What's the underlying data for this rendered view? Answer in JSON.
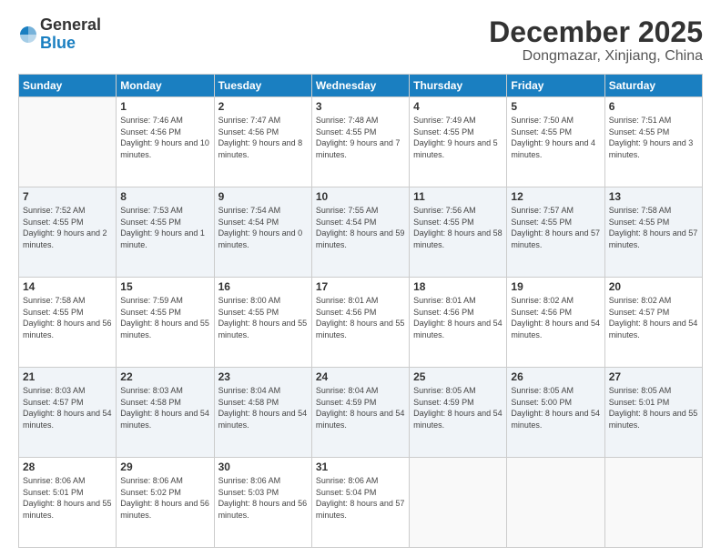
{
  "logo": {
    "general": "General",
    "blue": "Blue"
  },
  "header": {
    "month": "December 2025",
    "location": "Dongmazar, Xinjiang, China"
  },
  "weekdays": [
    "Sunday",
    "Monday",
    "Tuesday",
    "Wednesday",
    "Thursday",
    "Friday",
    "Saturday"
  ],
  "weeks": [
    [
      {
        "day": "",
        "sunrise": "",
        "sunset": "",
        "daylight": ""
      },
      {
        "day": "1",
        "sunrise": "Sunrise: 7:46 AM",
        "sunset": "Sunset: 4:56 PM",
        "daylight": "Daylight: 9 hours and 10 minutes."
      },
      {
        "day": "2",
        "sunrise": "Sunrise: 7:47 AM",
        "sunset": "Sunset: 4:56 PM",
        "daylight": "Daylight: 9 hours and 8 minutes."
      },
      {
        "day": "3",
        "sunrise": "Sunrise: 7:48 AM",
        "sunset": "Sunset: 4:55 PM",
        "daylight": "Daylight: 9 hours and 7 minutes."
      },
      {
        "day": "4",
        "sunrise": "Sunrise: 7:49 AM",
        "sunset": "Sunset: 4:55 PM",
        "daylight": "Daylight: 9 hours and 5 minutes."
      },
      {
        "day": "5",
        "sunrise": "Sunrise: 7:50 AM",
        "sunset": "Sunset: 4:55 PM",
        "daylight": "Daylight: 9 hours and 4 minutes."
      },
      {
        "day": "6",
        "sunrise": "Sunrise: 7:51 AM",
        "sunset": "Sunset: 4:55 PM",
        "daylight": "Daylight: 9 hours and 3 minutes."
      }
    ],
    [
      {
        "day": "7",
        "sunrise": "Sunrise: 7:52 AM",
        "sunset": "Sunset: 4:55 PM",
        "daylight": "Daylight: 9 hours and 2 minutes."
      },
      {
        "day": "8",
        "sunrise": "Sunrise: 7:53 AM",
        "sunset": "Sunset: 4:55 PM",
        "daylight": "Daylight: 9 hours and 1 minute."
      },
      {
        "day": "9",
        "sunrise": "Sunrise: 7:54 AM",
        "sunset": "Sunset: 4:54 PM",
        "daylight": "Daylight: 9 hours and 0 minutes."
      },
      {
        "day": "10",
        "sunrise": "Sunrise: 7:55 AM",
        "sunset": "Sunset: 4:54 PM",
        "daylight": "Daylight: 8 hours and 59 minutes."
      },
      {
        "day": "11",
        "sunrise": "Sunrise: 7:56 AM",
        "sunset": "Sunset: 4:55 PM",
        "daylight": "Daylight: 8 hours and 58 minutes."
      },
      {
        "day": "12",
        "sunrise": "Sunrise: 7:57 AM",
        "sunset": "Sunset: 4:55 PM",
        "daylight": "Daylight: 8 hours and 57 minutes."
      },
      {
        "day": "13",
        "sunrise": "Sunrise: 7:58 AM",
        "sunset": "Sunset: 4:55 PM",
        "daylight": "Daylight: 8 hours and 57 minutes."
      }
    ],
    [
      {
        "day": "14",
        "sunrise": "Sunrise: 7:58 AM",
        "sunset": "Sunset: 4:55 PM",
        "daylight": "Daylight: 8 hours and 56 minutes."
      },
      {
        "day": "15",
        "sunrise": "Sunrise: 7:59 AM",
        "sunset": "Sunset: 4:55 PM",
        "daylight": "Daylight: 8 hours and 55 minutes."
      },
      {
        "day": "16",
        "sunrise": "Sunrise: 8:00 AM",
        "sunset": "Sunset: 4:55 PM",
        "daylight": "Daylight: 8 hours and 55 minutes."
      },
      {
        "day": "17",
        "sunrise": "Sunrise: 8:01 AM",
        "sunset": "Sunset: 4:56 PM",
        "daylight": "Daylight: 8 hours and 55 minutes."
      },
      {
        "day": "18",
        "sunrise": "Sunrise: 8:01 AM",
        "sunset": "Sunset: 4:56 PM",
        "daylight": "Daylight: 8 hours and 54 minutes."
      },
      {
        "day": "19",
        "sunrise": "Sunrise: 8:02 AM",
        "sunset": "Sunset: 4:56 PM",
        "daylight": "Daylight: 8 hours and 54 minutes."
      },
      {
        "day": "20",
        "sunrise": "Sunrise: 8:02 AM",
        "sunset": "Sunset: 4:57 PM",
        "daylight": "Daylight: 8 hours and 54 minutes."
      }
    ],
    [
      {
        "day": "21",
        "sunrise": "Sunrise: 8:03 AM",
        "sunset": "Sunset: 4:57 PM",
        "daylight": "Daylight: 8 hours and 54 minutes."
      },
      {
        "day": "22",
        "sunrise": "Sunrise: 8:03 AM",
        "sunset": "Sunset: 4:58 PM",
        "daylight": "Daylight: 8 hours and 54 minutes."
      },
      {
        "day": "23",
        "sunrise": "Sunrise: 8:04 AM",
        "sunset": "Sunset: 4:58 PM",
        "daylight": "Daylight: 8 hours and 54 minutes."
      },
      {
        "day": "24",
        "sunrise": "Sunrise: 8:04 AM",
        "sunset": "Sunset: 4:59 PM",
        "daylight": "Daylight: 8 hours and 54 minutes."
      },
      {
        "day": "25",
        "sunrise": "Sunrise: 8:05 AM",
        "sunset": "Sunset: 4:59 PM",
        "daylight": "Daylight: 8 hours and 54 minutes."
      },
      {
        "day": "26",
        "sunrise": "Sunrise: 8:05 AM",
        "sunset": "Sunset: 5:00 PM",
        "daylight": "Daylight: 8 hours and 54 minutes."
      },
      {
        "day": "27",
        "sunrise": "Sunrise: 8:05 AM",
        "sunset": "Sunset: 5:01 PM",
        "daylight": "Daylight: 8 hours and 55 minutes."
      }
    ],
    [
      {
        "day": "28",
        "sunrise": "Sunrise: 8:06 AM",
        "sunset": "Sunset: 5:01 PM",
        "daylight": "Daylight: 8 hours and 55 minutes."
      },
      {
        "day": "29",
        "sunrise": "Sunrise: 8:06 AM",
        "sunset": "Sunset: 5:02 PM",
        "daylight": "Daylight: 8 hours and 56 minutes."
      },
      {
        "day": "30",
        "sunrise": "Sunrise: 8:06 AM",
        "sunset": "Sunset: 5:03 PM",
        "daylight": "Daylight: 8 hours and 56 minutes."
      },
      {
        "day": "31",
        "sunrise": "Sunrise: 8:06 AM",
        "sunset": "Sunset: 5:04 PM",
        "daylight": "Daylight: 8 hours and 57 minutes."
      },
      {
        "day": "",
        "sunrise": "",
        "sunset": "",
        "daylight": ""
      },
      {
        "day": "",
        "sunrise": "",
        "sunset": "",
        "daylight": ""
      },
      {
        "day": "",
        "sunrise": "",
        "sunset": "",
        "daylight": ""
      }
    ]
  ]
}
